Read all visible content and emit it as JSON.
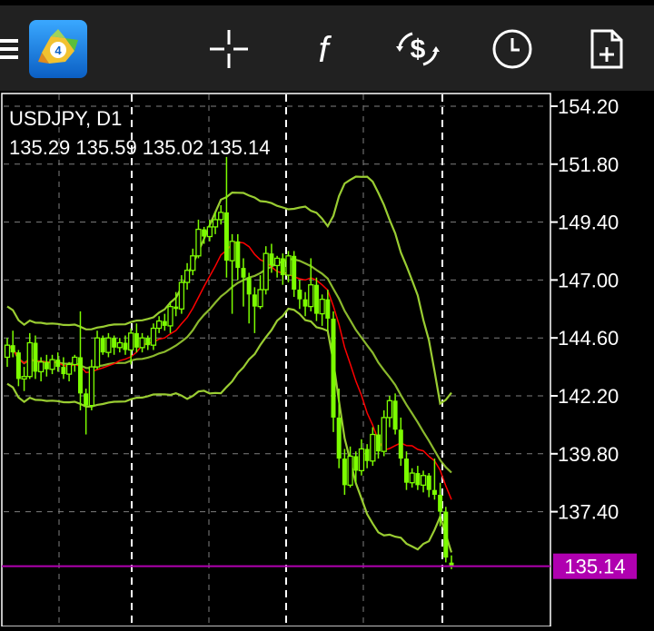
{
  "toolbar": {
    "items": [
      {
        "name": "menu-icon"
      },
      {
        "name": "mt4-logo"
      },
      {
        "name": "crosshair-icon"
      },
      {
        "name": "indicators-icon",
        "glyph": "f"
      },
      {
        "name": "trade-icon",
        "glyph": "$"
      },
      {
        "name": "history-clock-icon"
      },
      {
        "name": "new-order-icon"
      }
    ]
  },
  "chart": {
    "symbol_line": "USDJPY, D1",
    "ohlc_line": "135.29 135.59 135.02 135.14",
    "current_price_label": "135.14",
    "colors": {
      "background": "#000000",
      "candle": "#7cfc00",
      "bands": "#9acd32",
      "ma": "#ff0000",
      "price_line": "#b000b0",
      "grid": "#7f7f7f",
      "axis": "#ffffff"
    }
  },
  "chart_data": {
    "type": "candlestick",
    "y_axis_ticks": [
      "154.20",
      "151.80",
      "149.40",
      "147.00",
      "144.60",
      "142.20",
      "139.80",
      "137.40"
    ],
    "ylim": [
      132.8,
      154.7
    ],
    "current_price": 135.14,
    "candles": [
      [
        143.8,
        144.6,
        143.4,
        144.3
      ],
      [
        144.3,
        144.9,
        143.8,
        144.0
      ],
      [
        144.0,
        144.1,
        142.6,
        142.9
      ],
      [
        142.9,
        143.4,
        142.4,
        143.0
      ],
      [
        143.0,
        144.8,
        142.9,
        144.4
      ],
      [
        144.4,
        144.7,
        142.9,
        143.2
      ],
      [
        143.2,
        143.8,
        142.8,
        143.6
      ],
      [
        143.6,
        143.9,
        143.0,
        143.3
      ],
      [
        143.3,
        143.9,
        143.1,
        143.7
      ],
      [
        143.7,
        144.0,
        143.2,
        143.4
      ],
      [
        143.4,
        143.8,
        142.9,
        143.1
      ],
      [
        143.1,
        143.6,
        142.8,
        143.5
      ],
      [
        143.5,
        143.9,
        143.2,
        143.8
      ],
      [
        143.8,
        145.7,
        141.6,
        142.3
      ],
      [
        142.3,
        142.5,
        140.6,
        141.8
      ],
      [
        141.8,
        143.7,
        141.6,
        143.4
      ],
      [
        143.4,
        144.9,
        143.3,
        144.6
      ],
      [
        144.6,
        144.7,
        143.9,
        144.0
      ],
      [
        144.0,
        144.8,
        143.8,
        144.6
      ],
      [
        144.6,
        144.7,
        143.9,
        144.2
      ],
      [
        144.2,
        144.6,
        144.0,
        144.4
      ],
      [
        144.4,
        144.7,
        143.9,
        144.1
      ],
      [
        144.1,
        145.0,
        143.5,
        144.8
      ],
      [
        144.8,
        145.2,
        144.0,
        144.2
      ],
      [
        144.2,
        144.8,
        144.0,
        144.6
      ],
      [
        144.6,
        144.7,
        144.1,
        144.3
      ],
      [
        144.3,
        145.2,
        144.1,
        145.0
      ],
      [
        145.0,
        145.5,
        144.8,
        145.3
      ],
      [
        145.3,
        145.6,
        144.9,
        145.1
      ],
      [
        145.1,
        146.1,
        144.8,
        145.9
      ],
      [
        145.9,
        146.5,
        145.5,
        145.8
      ],
      [
        145.8,
        147.2,
        145.6,
        146.9
      ],
      [
        146.9,
        147.7,
        146.6,
        147.4
      ],
      [
        147.4,
        148.3,
        147.2,
        148.0
      ],
      [
        148.0,
        149.5,
        147.9,
        149.1
      ],
      [
        149.1,
        149.2,
        148.5,
        148.8
      ],
      [
        148.8,
        149.5,
        148.6,
        149.2
      ],
      [
        149.2,
        149.8,
        148.9,
        149.5
      ],
      [
        149.5,
        150.1,
        149.3,
        149.8
      ],
      [
        149.8,
        152.1,
        147.1,
        147.8
      ],
      [
        147.8,
        148.9,
        145.6,
        148.6
      ],
      [
        148.6,
        148.9,
        147.0,
        147.5
      ],
      [
        147.5,
        147.9,
        145.9,
        147.1
      ],
      [
        147.1,
        147.3,
        145.2,
        146.4
      ],
      [
        146.4,
        146.7,
        144.8,
        145.9
      ],
      [
        145.9,
        147.2,
        145.8,
        146.6
      ],
      [
        146.6,
        148.4,
        146.4,
        148.1
      ],
      [
        148.1,
        148.5,
        147.3,
        147.6
      ],
      [
        147.6,
        148.0,
        147.1,
        147.9
      ],
      [
        147.9,
        148.1,
        146.8,
        147.2
      ],
      [
        147.2,
        148.2,
        146.9,
        148.0
      ],
      [
        148.0,
        148.2,
        146.3,
        146.6
      ],
      [
        146.6,
        147.0,
        145.8,
        146.2
      ],
      [
        146.2,
        146.5,
        145.5,
        145.9
      ],
      [
        145.9,
        147.9,
        145.7,
        146.8
      ],
      [
        146.8,
        147.1,
        145.3,
        145.6
      ],
      [
        145.6,
        146.4,
        145.1,
        146.2
      ],
      [
        146.2,
        146.6,
        144.9,
        145.4
      ],
      [
        145.4,
        145.7,
        140.7,
        141.3
      ],
      [
        141.3,
        142.5,
        139.2,
        139.6
      ],
      [
        139.6,
        140.0,
        138.1,
        138.5
      ],
      [
        138.5,
        140.1,
        138.4,
        139.7
      ],
      [
        139.7,
        139.9,
        138.6,
        139.1
      ],
      [
        139.1,
        140.4,
        138.9,
        140.0
      ],
      [
        140.0,
        140.2,
        139.2,
        139.5
      ],
      [
        139.5,
        140.9,
        139.3,
        140.6
      ],
      [
        140.6,
        141.0,
        139.6,
        139.9
      ],
      [
        139.9,
        141.6,
        139.7,
        141.3
      ],
      [
        141.3,
        142.2,
        140.9,
        142.0
      ],
      [
        142.0,
        142.3,
        140.6,
        140.8
      ],
      [
        140.8,
        141.3,
        139.3,
        139.6
      ],
      [
        139.6,
        139.9,
        138.3,
        138.6
      ],
      [
        138.6,
        139.2,
        138.4,
        139.0
      ],
      [
        139.0,
        139.3,
        138.3,
        138.5
      ],
      [
        138.5,
        139.1,
        138.2,
        138.9
      ],
      [
        138.9,
        139.0,
        138.0,
        138.3
      ],
      [
        138.3,
        139.6,
        137.9,
        138.1
      ],
      [
        138.1,
        138.6,
        136.8,
        137.4
      ],
      [
        137.4,
        137.6,
        135.3,
        135.5
      ],
      [
        135.29,
        135.59,
        135.02,
        135.14
      ]
    ]
  }
}
